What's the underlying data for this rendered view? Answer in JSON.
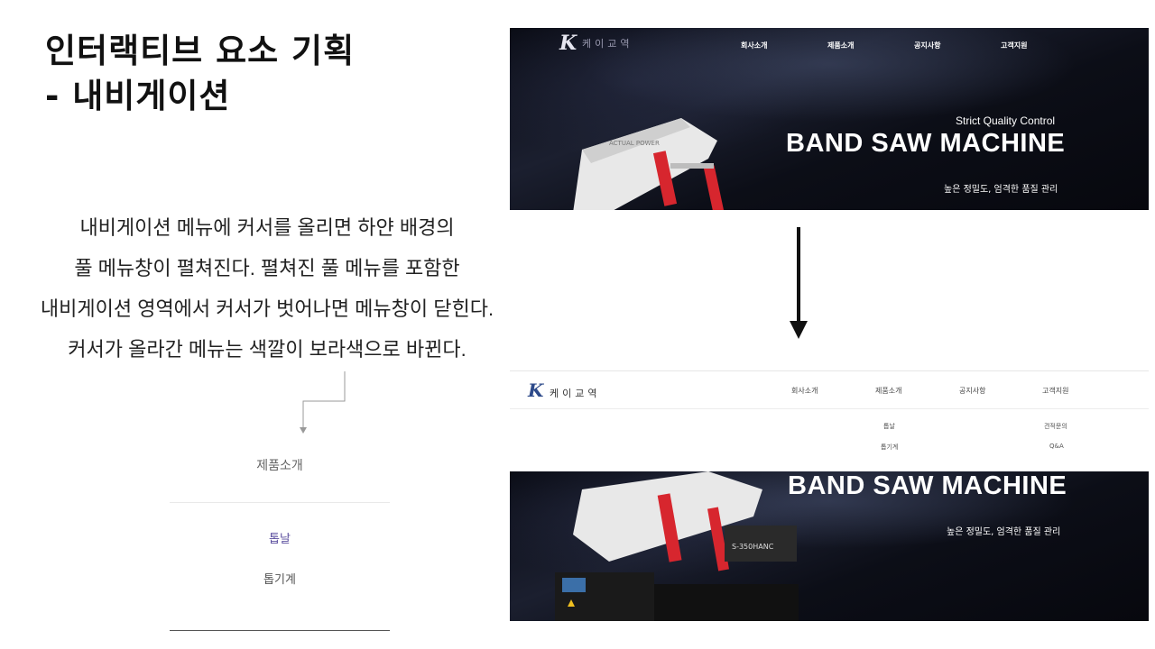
{
  "title": {
    "line1": "인터랙티브 요소 기획",
    "line2": "- 내비게이션"
  },
  "description": [
    "내비게이션 메뉴에 커서를 올리면 하얀 배경의",
    "풀 메뉴창이 펼쳐진다. 펼쳐진 풀 메뉴를 포함한",
    "내비게이션 영역에서 커서가 벗어나면 메뉴창이 닫힌다.",
    "커서가 올라간 메뉴는 색깔이 보라색으로 바뀐다."
  ],
  "detail_menu": {
    "header": "제품소개",
    "items": [
      "톱날",
      "톱기계"
    ],
    "active_index": 0,
    "active_color": "#5b4e9e"
  },
  "site": {
    "logo_mark": "K",
    "logo_text": "케이교역",
    "nav": [
      "회사소개",
      "제품소개",
      "공지사항",
      "고객지원"
    ],
    "banner": {
      "tagline": "Strict Quality Control",
      "headline": "BAND SAW MACHINE",
      "subline": "높은 정밀도, 엄격한 품질 관리",
      "machine_model": "S-350HANC"
    },
    "submenu": {
      "products": [
        "톱날",
        "톱기계"
      ],
      "support": [
        "견적문의",
        "Q&A"
      ]
    }
  },
  "icons": {
    "arrow": "arrow-down-icon",
    "connector": "connector-arrow-icon"
  }
}
